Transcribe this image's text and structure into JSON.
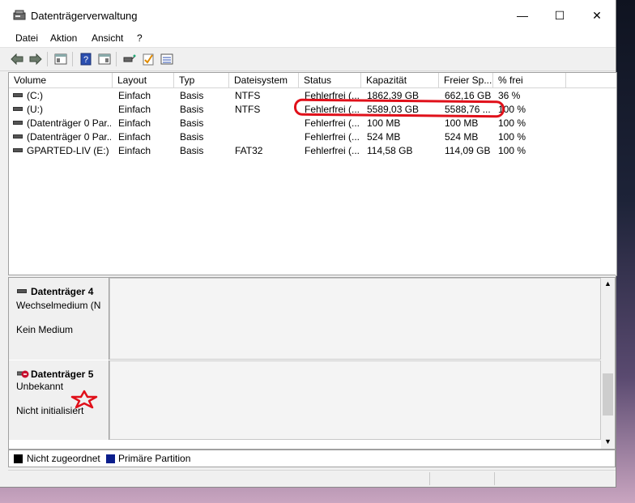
{
  "window": {
    "title": "Datenträgerverwaltung",
    "controls": {
      "minimize": "—",
      "maximize": "☐",
      "close": "✕"
    }
  },
  "menu": [
    "Datei",
    "Aktion",
    "Ansicht",
    "?"
  ],
  "toolbar": [
    "back",
    "forward",
    "up",
    "help",
    "properties",
    "connect",
    "check",
    "list"
  ],
  "volume_list": {
    "columns": [
      "Volume",
      "Layout",
      "Typ",
      "Dateisystem",
      "Status",
      "Kapazität",
      "Freier Sp...",
      "% frei"
    ],
    "rows": [
      [
        "(C:)",
        "Einfach",
        "Basis",
        "NTFS",
        "Fehlerfrei (...",
        "1862,39 GB",
        "662,16 GB",
        "36 %"
      ],
      [
        "(U:)",
        "Einfach",
        "Basis",
        "NTFS",
        "Fehlerfrei (...",
        "5589,03 GB",
        "5588,76 ...",
        "100 %"
      ],
      [
        "(Datenträger 0 Par...",
        "Einfach",
        "Basis",
        "",
        "Fehlerfrei (...",
        "100 MB",
        "100 MB",
        "100 %"
      ],
      [
        "(Datenträger 0 Par...",
        "Einfach",
        "Basis",
        "",
        "Fehlerfrei (...",
        "524 MB",
        "524 MB",
        "100 %"
      ],
      [
        "GPARTED-LIV (E:)",
        "Einfach",
        "Basis",
        "FAT32",
        "Fehlerfrei (...",
        "114,58 GB",
        "114,09 GB",
        "100 %"
      ]
    ]
  },
  "disks": [
    {
      "name": "Datenträger 4",
      "type": "Wechselmedium (N",
      "state": "Kein Medium"
    },
    {
      "name": "Datenträger 5",
      "type": "Unbekannt",
      "state": "Nicht initialisiert"
    }
  ],
  "legend": [
    {
      "label": "Nicht zugeordnet",
      "color": "#000000"
    },
    {
      "label": "Primäre Partition",
      "color": "#0b1e8c"
    }
  ],
  "annotation_color": "#e0101a"
}
